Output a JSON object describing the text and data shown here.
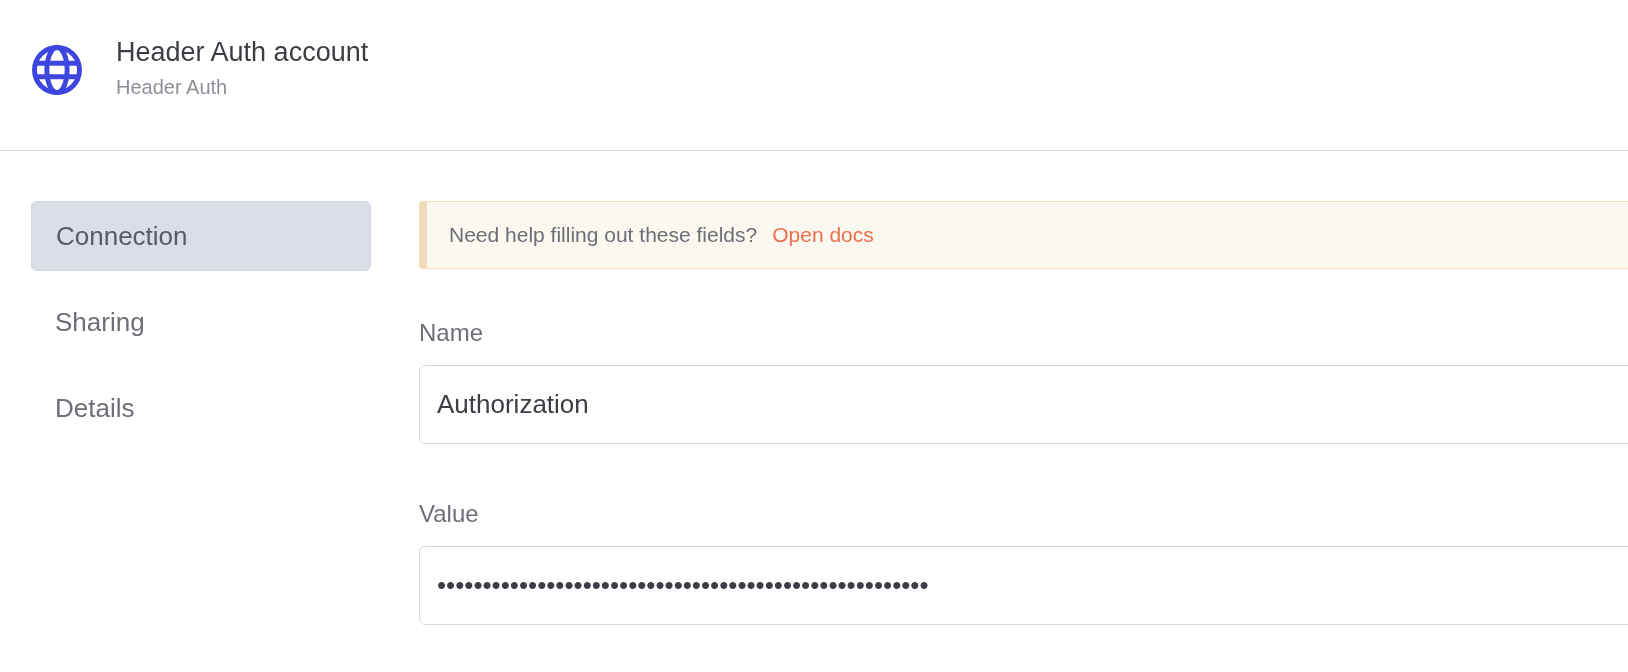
{
  "header": {
    "title": "Header Auth account",
    "subtitle": "Header Auth"
  },
  "sidebar": {
    "items": [
      {
        "label": "Connection",
        "selected": true
      },
      {
        "label": "Sharing",
        "selected": false
      },
      {
        "label": "Details",
        "selected": false
      }
    ]
  },
  "notice": {
    "text": "Need help filling out these fields?",
    "link": "Open docs"
  },
  "fields": [
    {
      "label": "Name",
      "value": "Authorization"
    },
    {
      "label": "Value",
      "value": "••••••••••••••••••••••••••••••••••••••••••••••••••••••"
    }
  ]
}
